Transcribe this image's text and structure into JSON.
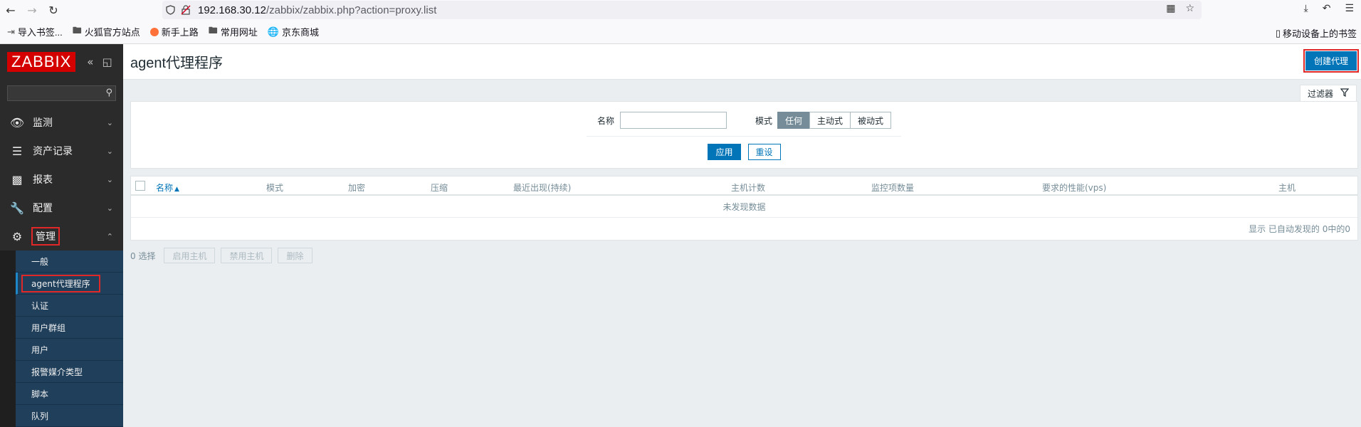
{
  "browser": {
    "url_host": "192.168.30.12",
    "url_path": "/zabbix/zabbix.php?action=proxy.list",
    "bookmarks": [
      {
        "icon": "import-icon",
        "label": "导入书签..."
      },
      {
        "icon": "folder-icon",
        "label": "火狐官方站点"
      },
      {
        "icon": "firefox-icon",
        "label": "新手上路"
      },
      {
        "icon": "folder-icon",
        "label": "常用网址"
      },
      {
        "icon": "globe-icon",
        "label": "京东商城"
      }
    ],
    "mobile_bookmarks": "移动设备上的书签"
  },
  "sidebar": {
    "logo": "ZABBIX",
    "menu": [
      {
        "icon": "eye-icon",
        "label": "监测"
      },
      {
        "icon": "list-icon",
        "label": "资产记录"
      },
      {
        "icon": "bar-chart-icon",
        "label": "报表"
      },
      {
        "icon": "wrench-icon",
        "label": "配置"
      },
      {
        "icon": "gear-icon",
        "label": "管理"
      }
    ],
    "submenu": [
      "一般",
      "agent代理程序",
      "认证",
      "用户群组",
      "用户",
      "报警媒介类型",
      "脚本",
      "队列"
    ]
  },
  "page": {
    "title": "agent代理程序",
    "create_button": "创建代理",
    "filter_tab": "过滤器"
  },
  "filter": {
    "name_label": "名称",
    "mode_label": "模式",
    "modes": [
      "任何",
      "主动式",
      "被动式"
    ],
    "selected_mode": "任何",
    "apply": "应用",
    "reset": "重设"
  },
  "table": {
    "columns": [
      "名称",
      "模式",
      "加密",
      "压缩",
      "最近出现(持续)",
      "主机计数",
      "监控项数量",
      "要求的性能(vps)",
      "主机"
    ],
    "sorted_column": "名称",
    "empty_text": "未发现数据",
    "footer": "显示 已自动发现的 0中的0"
  },
  "actions": {
    "selected": "0 选择",
    "buttons": [
      "启用主机",
      "禁用主机",
      "删除"
    ]
  }
}
